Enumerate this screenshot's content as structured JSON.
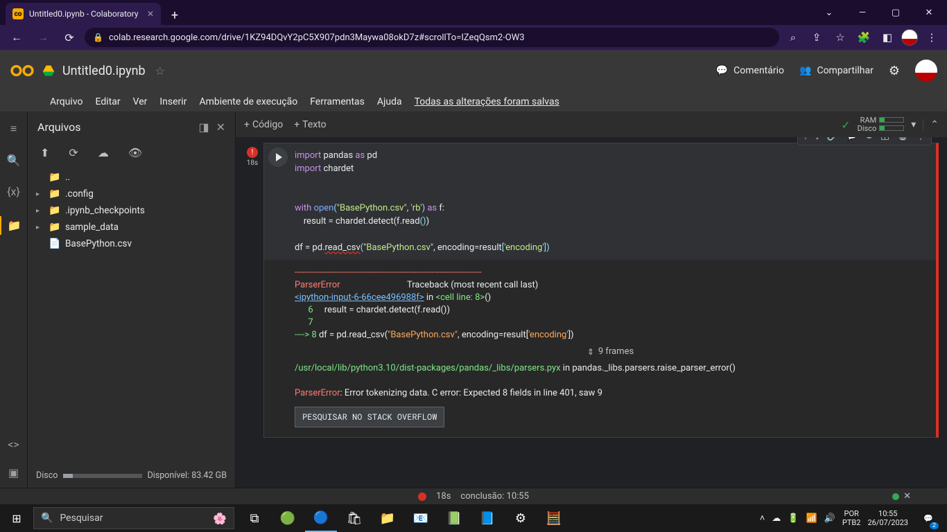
{
  "browser": {
    "tab_title": "Untitled0.ipynb - Colaboratory",
    "url": "colab.research.google.com/drive/1KZ94DQvY2pC5X907pdn3Maywa08okD7z#scrollTo=IZeqQsm2-OW3"
  },
  "colab": {
    "doc_title": "Untitled0.ipynb",
    "comment": "Comentário",
    "share": "Compartilhar",
    "menus": [
      "Arquivo",
      "Editar",
      "Ver",
      "Inserir",
      "Ambiente de execução",
      "Ferramentas",
      "Ajuda"
    ],
    "save_status": "Todas as alterações foram salvas",
    "add_code": "Código",
    "add_text": "Texto",
    "ram": "RAM",
    "disk": "Disco"
  },
  "files": {
    "title": "Arquivos",
    "tree": [
      {
        "icon": "folder",
        "label": "..",
        "chev": ""
      },
      {
        "icon": "folder",
        "label": ".config",
        "chev": "▸"
      },
      {
        "icon": "folder",
        "label": ".ipynb_checkpoints",
        "chev": "▸"
      },
      {
        "icon": "folder",
        "label": "sample_data",
        "chev": "▸"
      },
      {
        "icon": "file",
        "label": "BasePython.csv",
        "chev": ""
      }
    ],
    "disk_label": "Disco",
    "disk_avail": "Disponível: 83.42 GB"
  },
  "cell": {
    "exec_time": "18s",
    "code_lines": [
      [
        {
          "t": "import ",
          "c": "kw"
        },
        {
          "t": "pandas ",
          "c": ""
        },
        {
          "t": "as ",
          "c": "kw"
        },
        {
          "t": "pd",
          "c": ""
        }
      ],
      [
        {
          "t": "import ",
          "c": "kw"
        },
        {
          "t": "chardet",
          "c": ""
        }
      ],
      [
        {
          "t": "",
          "c": ""
        }
      ],
      [
        {
          "t": "",
          "c": ""
        }
      ],
      [
        {
          "t": "with ",
          "c": "kw"
        },
        {
          "t": "open",
          "c": "fn"
        },
        {
          "t": "(",
          "c": "op"
        },
        {
          "t": "\"BasePython.csv\"",
          "c": "str"
        },
        {
          "t": ", ",
          "c": ""
        },
        {
          "t": "'rb'",
          "c": "str"
        },
        {
          "t": ") ",
          "c": "op"
        },
        {
          "t": "as ",
          "c": "kw"
        },
        {
          "t": "f:",
          "c": ""
        }
      ],
      [
        {
          "t": "    result = chardet.detect(f.read",
          "c": ""
        },
        {
          "t": "()",
          "c": "op"
        },
        {
          "t": ")",
          "c": ""
        }
      ],
      [
        {
          "t": "",
          "c": ""
        }
      ],
      [
        {
          "t": "df = pd.",
          "c": ""
        },
        {
          "t": "read_csv",
          "c": "wavy"
        },
        {
          "t": "(",
          "c": "op"
        },
        {
          "t": "\"BasePython.csv\"",
          "c": "str"
        },
        {
          "t": ", encoding=result",
          "c": ""
        },
        {
          "t": "[",
          "c": "op"
        },
        {
          "t": "'encoding'",
          "c": "str"
        },
        {
          "t": "]",
          "c": "op"
        },
        {
          "t": ")",
          "c": "op"
        }
      ]
    ],
    "dashline": "---------------------------------------------------------------------------",
    "err_header_name": "ParserError",
    "err_header_tb": "Traceback (most recent call last)",
    "tb_loc": "<ipython-input-6-66cee496988f>",
    "tb_in": " in ",
    "tb_cell": "<cell line: 8>",
    "tb_paren": "()",
    "tb_line6_num": "      6",
    "tb_line6_code": "     result = chardet.detect(f.read())",
    "tb_line7": "      7",
    "tb_arrow": "----> ",
    "tb_line8_num": "8",
    "tb_line8_code": " df = pd.read_csv(",
    "tb_line8_str": "\"BasePython.csv\"",
    "tb_line8_rest": ", encoding=result[",
    "tb_line8_enc": "'encoding'",
    "tb_line8_close": "])",
    "frames": "9 frames",
    "tb_path": "/usr/local/lib/python3.10/dist-packages/pandas/_libs/parsers.pyx",
    "tb_path_in": " in ",
    "tb_path_fn": "pandas._libs.parsers.raise_parser_error()",
    "final_err_name": "ParserError",
    "final_err_msg": ": Error tokenizing data. C error: Expected 8 fields in line 401, saw 9",
    "so_button": "PESQUISAR NO STACK OVERFLOW"
  },
  "status": {
    "time": "18s",
    "completion": "conclusão: 10:55"
  },
  "taskbar": {
    "search_placeholder": "Pesquisar",
    "lang": "POR",
    "kbd": "PTB2",
    "time": "10:55",
    "date": "26/07/2023",
    "notif": "2"
  }
}
